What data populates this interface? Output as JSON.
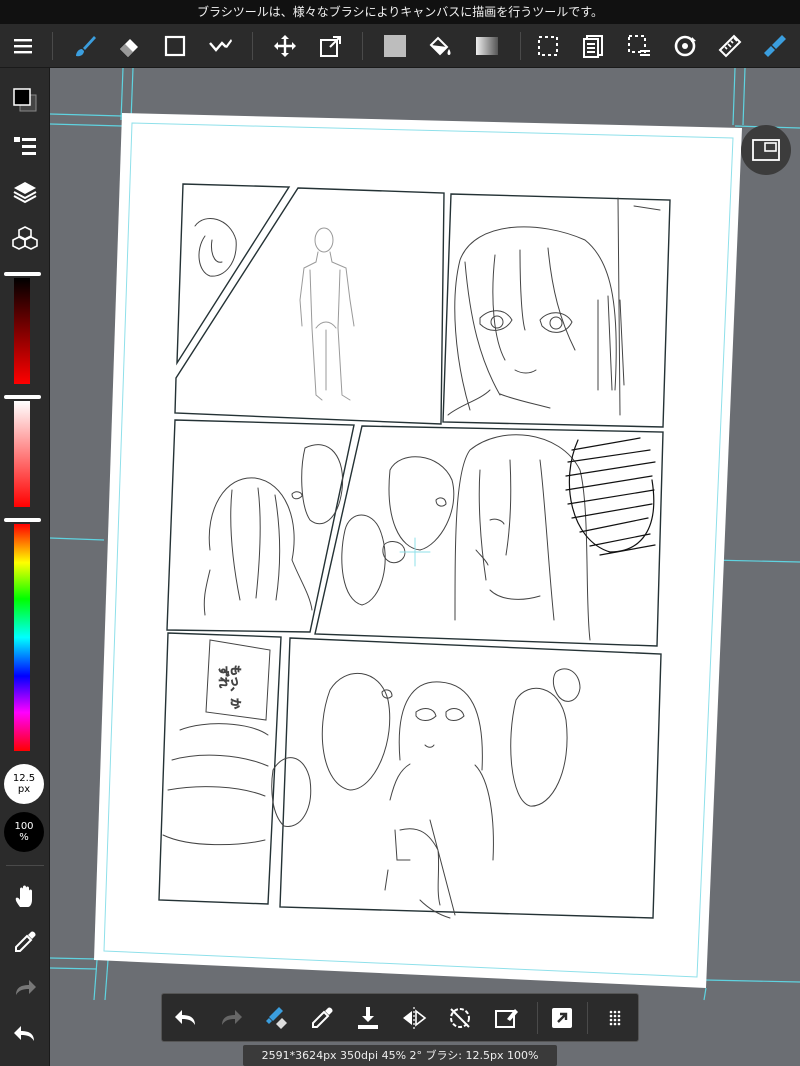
{
  "hint": "ブラシツールは、様々なブラシによりキャンバスに描画を行うツールです。",
  "toolbar": {
    "accent": "#3b9ede",
    "items": [
      "menu-icon",
      "brush-icon",
      "eraser-icon",
      "shape-icon",
      "line-icon",
      "move-icon",
      "transform-icon",
      "fill-color-icon",
      "bucket-icon",
      "gradient-icon",
      "select-icon",
      "copy-icon",
      "select-layer-icon",
      "rotate-icon",
      "ruler-icon",
      "tone-pen-icon"
    ]
  },
  "sidebar": {
    "brush_size_value": "12.5",
    "brush_size_unit": "px",
    "opacity_value": "100",
    "opacity_unit": "%"
  },
  "status": "2591*3624px 350dpi 45% 2° ブラシ: 12.5px 100%",
  "colors": {
    "bar": "#2b2b2b",
    "canvas_bg": "#6b6e73",
    "guide": "#5fd3e0",
    "ink": "#2a2a2a"
  }
}
